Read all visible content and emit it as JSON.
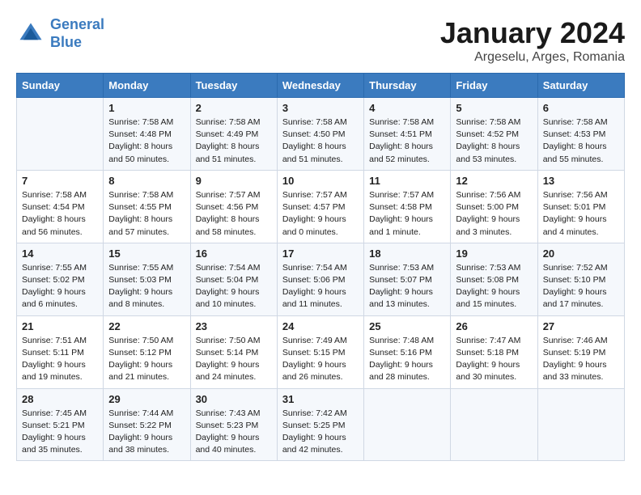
{
  "header": {
    "logo_line1": "General",
    "logo_line2": "Blue",
    "title": "January 2024",
    "subtitle": "Argeselu, Arges, Romania"
  },
  "weekdays": [
    "Sunday",
    "Monday",
    "Tuesday",
    "Wednesday",
    "Thursday",
    "Friday",
    "Saturday"
  ],
  "weeks": [
    [
      {
        "day": "",
        "sunrise": "",
        "sunset": "",
        "daylight": ""
      },
      {
        "day": "1",
        "sunrise": "Sunrise: 7:58 AM",
        "sunset": "Sunset: 4:48 PM",
        "daylight": "Daylight: 8 hours and 50 minutes."
      },
      {
        "day": "2",
        "sunrise": "Sunrise: 7:58 AM",
        "sunset": "Sunset: 4:49 PM",
        "daylight": "Daylight: 8 hours and 51 minutes."
      },
      {
        "day": "3",
        "sunrise": "Sunrise: 7:58 AM",
        "sunset": "Sunset: 4:50 PM",
        "daylight": "Daylight: 8 hours and 51 minutes."
      },
      {
        "day": "4",
        "sunrise": "Sunrise: 7:58 AM",
        "sunset": "Sunset: 4:51 PM",
        "daylight": "Daylight: 8 hours and 52 minutes."
      },
      {
        "day": "5",
        "sunrise": "Sunrise: 7:58 AM",
        "sunset": "Sunset: 4:52 PM",
        "daylight": "Daylight: 8 hours and 53 minutes."
      },
      {
        "day": "6",
        "sunrise": "Sunrise: 7:58 AM",
        "sunset": "Sunset: 4:53 PM",
        "daylight": "Daylight: 8 hours and 55 minutes."
      }
    ],
    [
      {
        "day": "7",
        "sunrise": "Sunrise: 7:58 AM",
        "sunset": "Sunset: 4:54 PM",
        "daylight": "Daylight: 8 hours and 56 minutes."
      },
      {
        "day": "8",
        "sunrise": "Sunrise: 7:58 AM",
        "sunset": "Sunset: 4:55 PM",
        "daylight": "Daylight: 8 hours and 57 minutes."
      },
      {
        "day": "9",
        "sunrise": "Sunrise: 7:57 AM",
        "sunset": "Sunset: 4:56 PM",
        "daylight": "Daylight: 8 hours and 58 minutes."
      },
      {
        "day": "10",
        "sunrise": "Sunrise: 7:57 AM",
        "sunset": "Sunset: 4:57 PM",
        "daylight": "Daylight: 9 hours and 0 minutes."
      },
      {
        "day": "11",
        "sunrise": "Sunrise: 7:57 AM",
        "sunset": "Sunset: 4:58 PM",
        "daylight": "Daylight: 9 hours and 1 minute."
      },
      {
        "day": "12",
        "sunrise": "Sunrise: 7:56 AM",
        "sunset": "Sunset: 5:00 PM",
        "daylight": "Daylight: 9 hours and 3 minutes."
      },
      {
        "day": "13",
        "sunrise": "Sunrise: 7:56 AM",
        "sunset": "Sunset: 5:01 PM",
        "daylight": "Daylight: 9 hours and 4 minutes."
      }
    ],
    [
      {
        "day": "14",
        "sunrise": "Sunrise: 7:55 AM",
        "sunset": "Sunset: 5:02 PM",
        "daylight": "Daylight: 9 hours and 6 minutes."
      },
      {
        "day": "15",
        "sunrise": "Sunrise: 7:55 AM",
        "sunset": "Sunset: 5:03 PM",
        "daylight": "Daylight: 9 hours and 8 minutes."
      },
      {
        "day": "16",
        "sunrise": "Sunrise: 7:54 AM",
        "sunset": "Sunset: 5:04 PM",
        "daylight": "Daylight: 9 hours and 10 minutes."
      },
      {
        "day": "17",
        "sunrise": "Sunrise: 7:54 AM",
        "sunset": "Sunset: 5:06 PM",
        "daylight": "Daylight: 9 hours and 11 minutes."
      },
      {
        "day": "18",
        "sunrise": "Sunrise: 7:53 AM",
        "sunset": "Sunset: 5:07 PM",
        "daylight": "Daylight: 9 hours and 13 minutes."
      },
      {
        "day": "19",
        "sunrise": "Sunrise: 7:53 AM",
        "sunset": "Sunset: 5:08 PM",
        "daylight": "Daylight: 9 hours and 15 minutes."
      },
      {
        "day": "20",
        "sunrise": "Sunrise: 7:52 AM",
        "sunset": "Sunset: 5:10 PM",
        "daylight": "Daylight: 9 hours and 17 minutes."
      }
    ],
    [
      {
        "day": "21",
        "sunrise": "Sunrise: 7:51 AM",
        "sunset": "Sunset: 5:11 PM",
        "daylight": "Daylight: 9 hours and 19 minutes."
      },
      {
        "day": "22",
        "sunrise": "Sunrise: 7:50 AM",
        "sunset": "Sunset: 5:12 PM",
        "daylight": "Daylight: 9 hours and 21 minutes."
      },
      {
        "day": "23",
        "sunrise": "Sunrise: 7:50 AM",
        "sunset": "Sunset: 5:14 PM",
        "daylight": "Daylight: 9 hours and 24 minutes."
      },
      {
        "day": "24",
        "sunrise": "Sunrise: 7:49 AM",
        "sunset": "Sunset: 5:15 PM",
        "daylight": "Daylight: 9 hours and 26 minutes."
      },
      {
        "day": "25",
        "sunrise": "Sunrise: 7:48 AM",
        "sunset": "Sunset: 5:16 PM",
        "daylight": "Daylight: 9 hours and 28 minutes."
      },
      {
        "day": "26",
        "sunrise": "Sunrise: 7:47 AM",
        "sunset": "Sunset: 5:18 PM",
        "daylight": "Daylight: 9 hours and 30 minutes."
      },
      {
        "day": "27",
        "sunrise": "Sunrise: 7:46 AM",
        "sunset": "Sunset: 5:19 PM",
        "daylight": "Daylight: 9 hours and 33 minutes."
      }
    ],
    [
      {
        "day": "28",
        "sunrise": "Sunrise: 7:45 AM",
        "sunset": "Sunset: 5:21 PM",
        "daylight": "Daylight: 9 hours and 35 minutes."
      },
      {
        "day": "29",
        "sunrise": "Sunrise: 7:44 AM",
        "sunset": "Sunset: 5:22 PM",
        "daylight": "Daylight: 9 hours and 38 minutes."
      },
      {
        "day": "30",
        "sunrise": "Sunrise: 7:43 AM",
        "sunset": "Sunset: 5:23 PM",
        "daylight": "Daylight: 9 hours and 40 minutes."
      },
      {
        "day": "31",
        "sunrise": "Sunrise: 7:42 AM",
        "sunset": "Sunset: 5:25 PM",
        "daylight": "Daylight: 9 hours and 42 minutes."
      },
      {
        "day": "",
        "sunrise": "",
        "sunset": "",
        "daylight": ""
      },
      {
        "day": "",
        "sunrise": "",
        "sunset": "",
        "daylight": ""
      },
      {
        "day": "",
        "sunrise": "",
        "sunset": "",
        "daylight": ""
      }
    ]
  ]
}
